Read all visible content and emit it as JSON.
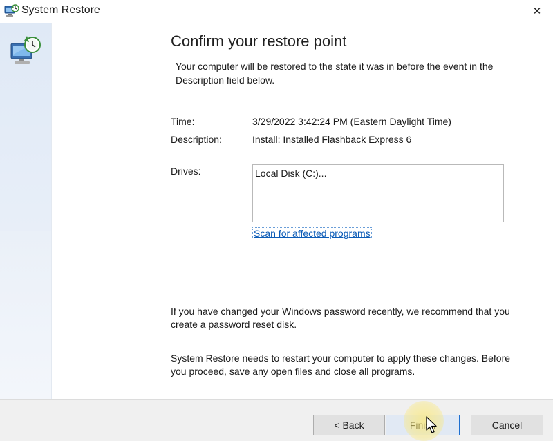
{
  "window": {
    "title": "System Restore",
    "close_glyph": "✕"
  },
  "page": {
    "heading": "Confirm your restore point",
    "intro": "Your computer will be restored to the state it was in before the event in the Description field below.",
    "time_label": "Time:",
    "time_value": "3/29/2022 3:42:24 PM (Eastern Daylight Time)",
    "description_label": "Description:",
    "description_value": "Install: Installed Flashback Express 6",
    "drives_label": "Drives:",
    "drives": [
      "Local Disk (C:)..."
    ],
    "scan_link": "Scan for affected programs",
    "password_note": "If you have changed your Windows password recently, we recommend that you create a password reset disk.",
    "restart_note": "System Restore needs to restart your computer to apply these changes. Before you proceed, save any open files and close all programs."
  },
  "footer": {
    "back_label": "< Back",
    "finish_label": "Finish",
    "cancel_label": "Cancel"
  },
  "icons": {
    "title": "system-restore-icon",
    "sidebar": "system-restore-computer-icon",
    "close": "close-icon",
    "cursor": "mouse-cursor-icon"
  },
  "colors": {
    "link": "#0b5bb7",
    "sidebar": "#e7eef8",
    "footer": "#f0f0f0",
    "focus_border": "#1e6fd0",
    "click_highlight": "#fae878"
  }
}
